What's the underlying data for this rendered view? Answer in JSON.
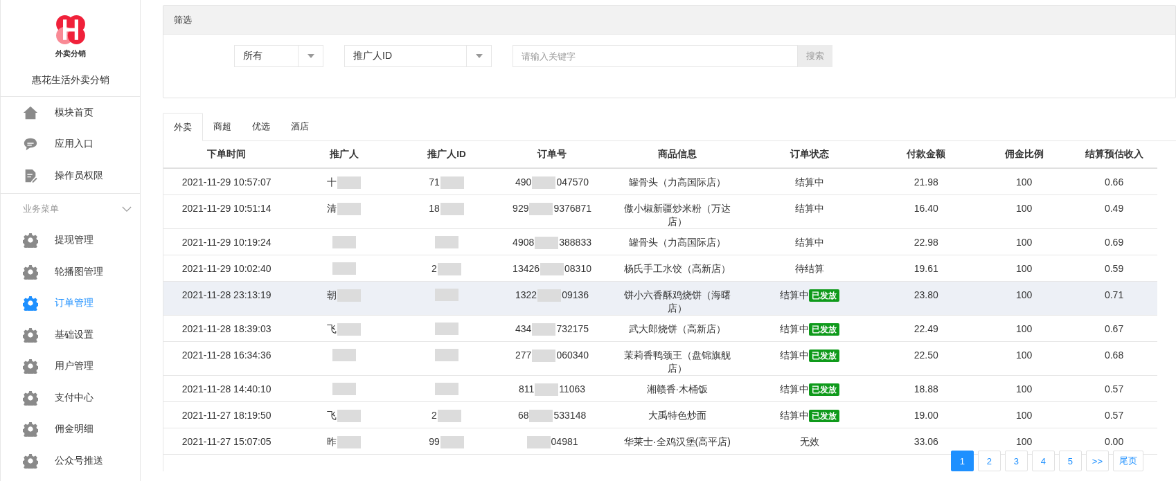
{
  "sidebar": {
    "logo_text": "外卖分销",
    "app_name": "惠花生活外卖分销",
    "items": [
      {
        "label": "模块首页",
        "kind": "home",
        "selected": false
      },
      {
        "label": "应用入口",
        "kind": "chat",
        "selected": false
      },
      {
        "label": "操作员权限",
        "kind": "doc",
        "selected": false
      }
    ],
    "section": {
      "title": "业务菜单",
      "expanded": true,
      "items": [
        {
          "label": "提现管理",
          "kind": "gear",
          "selected": false
        },
        {
          "label": "轮播图管理",
          "kind": "gear",
          "selected": false
        },
        {
          "label": "订单管理",
          "kind": "gear",
          "selected": true
        },
        {
          "label": "基础设置",
          "kind": "gear",
          "selected": false
        },
        {
          "label": "用户管理",
          "kind": "gear",
          "selected": false
        },
        {
          "label": "支付中心",
          "kind": "gear",
          "selected": false
        },
        {
          "label": "佣金明细",
          "kind": "gear",
          "selected": false
        },
        {
          "label": "公众号推送",
          "kind": "gear",
          "selected": false
        }
      ]
    }
  },
  "filter": {
    "title": "筛选",
    "select_1": "所有",
    "select_2": "推广人ID",
    "keyword": {
      "placeholder": "请输入关键字"
    },
    "search_button": "搜索"
  },
  "tabs": [
    {
      "label": "外卖",
      "selected": true
    },
    {
      "label": "商超",
      "selected": false
    },
    {
      "label": "优选",
      "selected": false
    },
    {
      "label": "酒店",
      "selected": false
    }
  ],
  "table": {
    "columns": [
      "下单时间",
      "推广人",
      "推广人ID",
      "订单号",
      "商品信息",
      "订单状态",
      "付款金额",
      "佣金比例",
      "结算预估收入"
    ],
    "rows": [
      {
        "time": "2021-11-29 10:57:07",
        "promoter": "十",
        "promoter_id": "71",
        "order_head": "490",
        "order_tail": "047570",
        "product": "罐骨头（力高国际店）",
        "status": "结算中",
        "amount": "21.98",
        "ratio": "100",
        "income": "0.66",
        "highlighted": false
      },
      {
        "time": "2021-11-29 10:51:14",
        "promoter": "清",
        "promoter_id": "18",
        "order_head": "929",
        "order_tail": "9376871",
        "product": "傲小椒新疆炒米粉（万达店）",
        "status": "结算中",
        "amount": "16.40",
        "ratio": "100",
        "income": "0.49",
        "highlighted": false
      },
      {
        "time": "2021-11-29 10:19:24",
        "order_head": "4908",
        "order_tail": "388833",
        "product": "罐骨头（力高国际店）",
        "status": "结算中",
        "amount": "22.98",
        "ratio": "100",
        "income": "0.69",
        "highlighted": false
      },
      {
        "time": "2021-11-29 10:02:40",
        "promoter_id": "2",
        "order_head": "13426",
        "order_tail": "08310",
        "product": "杨氏手工水饺（高新店）",
        "status": "待结算",
        "amount": "19.61",
        "ratio": "100",
        "income": "0.59",
        "highlighted": false
      },
      {
        "time": "2021-11-28 23:13:19",
        "promoter": "朝",
        "order_head": "1322",
        "order_tail": "09136",
        "product": "饼小六香酥鸡烧饼（海曙店）",
        "status": "结算中",
        "badge": "已发放",
        "amount": "23.80",
        "ratio": "100",
        "income": "0.71",
        "highlighted": true
      },
      {
        "time": "2021-11-28 18:39:03",
        "promoter": "飞",
        "order_head": "434",
        "order_tail": "732175",
        "product": "武大郎烧饼（高新店）",
        "status": "结算中",
        "badge": "已发放",
        "amount": "22.49",
        "ratio": "100",
        "income": "0.67",
        "highlighted": false
      },
      {
        "time": "2021-11-28 16:34:36",
        "order_head": "277",
        "order_tail": "060340",
        "product": "茉莉香鸭颈王（盘锦旗舰店）",
        "status": "结算中",
        "badge": "已发放",
        "amount": "22.50",
        "ratio": "100",
        "income": "0.68",
        "highlighted": false
      },
      {
        "time": "2021-11-28 14:40:10",
        "order_head": "811",
        "order_tail": "11063",
        "product": "湘赣香·木桶饭",
        "status": "结算中",
        "badge": "已发放",
        "amount": "18.88",
        "ratio": "100",
        "income": "0.57",
        "highlighted": false
      },
      {
        "time": "2021-11-27 18:19:50",
        "promoter": "飞",
        "promoter_id": "2",
        "order_head": "68",
        "order_tail": "533148",
        "product": "大禹特色炒面",
        "status": "结算中",
        "badge": "已发放",
        "amount": "19.00",
        "ratio": "100",
        "income": "0.57",
        "highlighted": false
      },
      {
        "time": "2021-11-27 15:07:05",
        "promoter": "昨",
        "promoter_id": "99",
        "order_tail": "04981",
        "product": "华莱士·全鸡汉堡(高平店)",
        "status": "无效",
        "amount": "33.06",
        "ratio": "100",
        "income": "0.00",
        "highlighted": false
      }
    ]
  },
  "pagination": [
    {
      "label": "1",
      "selected": true
    },
    {
      "label": "2",
      "selected": false
    },
    {
      "label": "3",
      "selected": false
    },
    {
      "label": "4",
      "selected": false
    },
    {
      "label": "5",
      "selected": false
    },
    {
      "label": ">>",
      "selected": false
    },
    {
      "label": "尾页",
      "selected": false
    }
  ]
}
